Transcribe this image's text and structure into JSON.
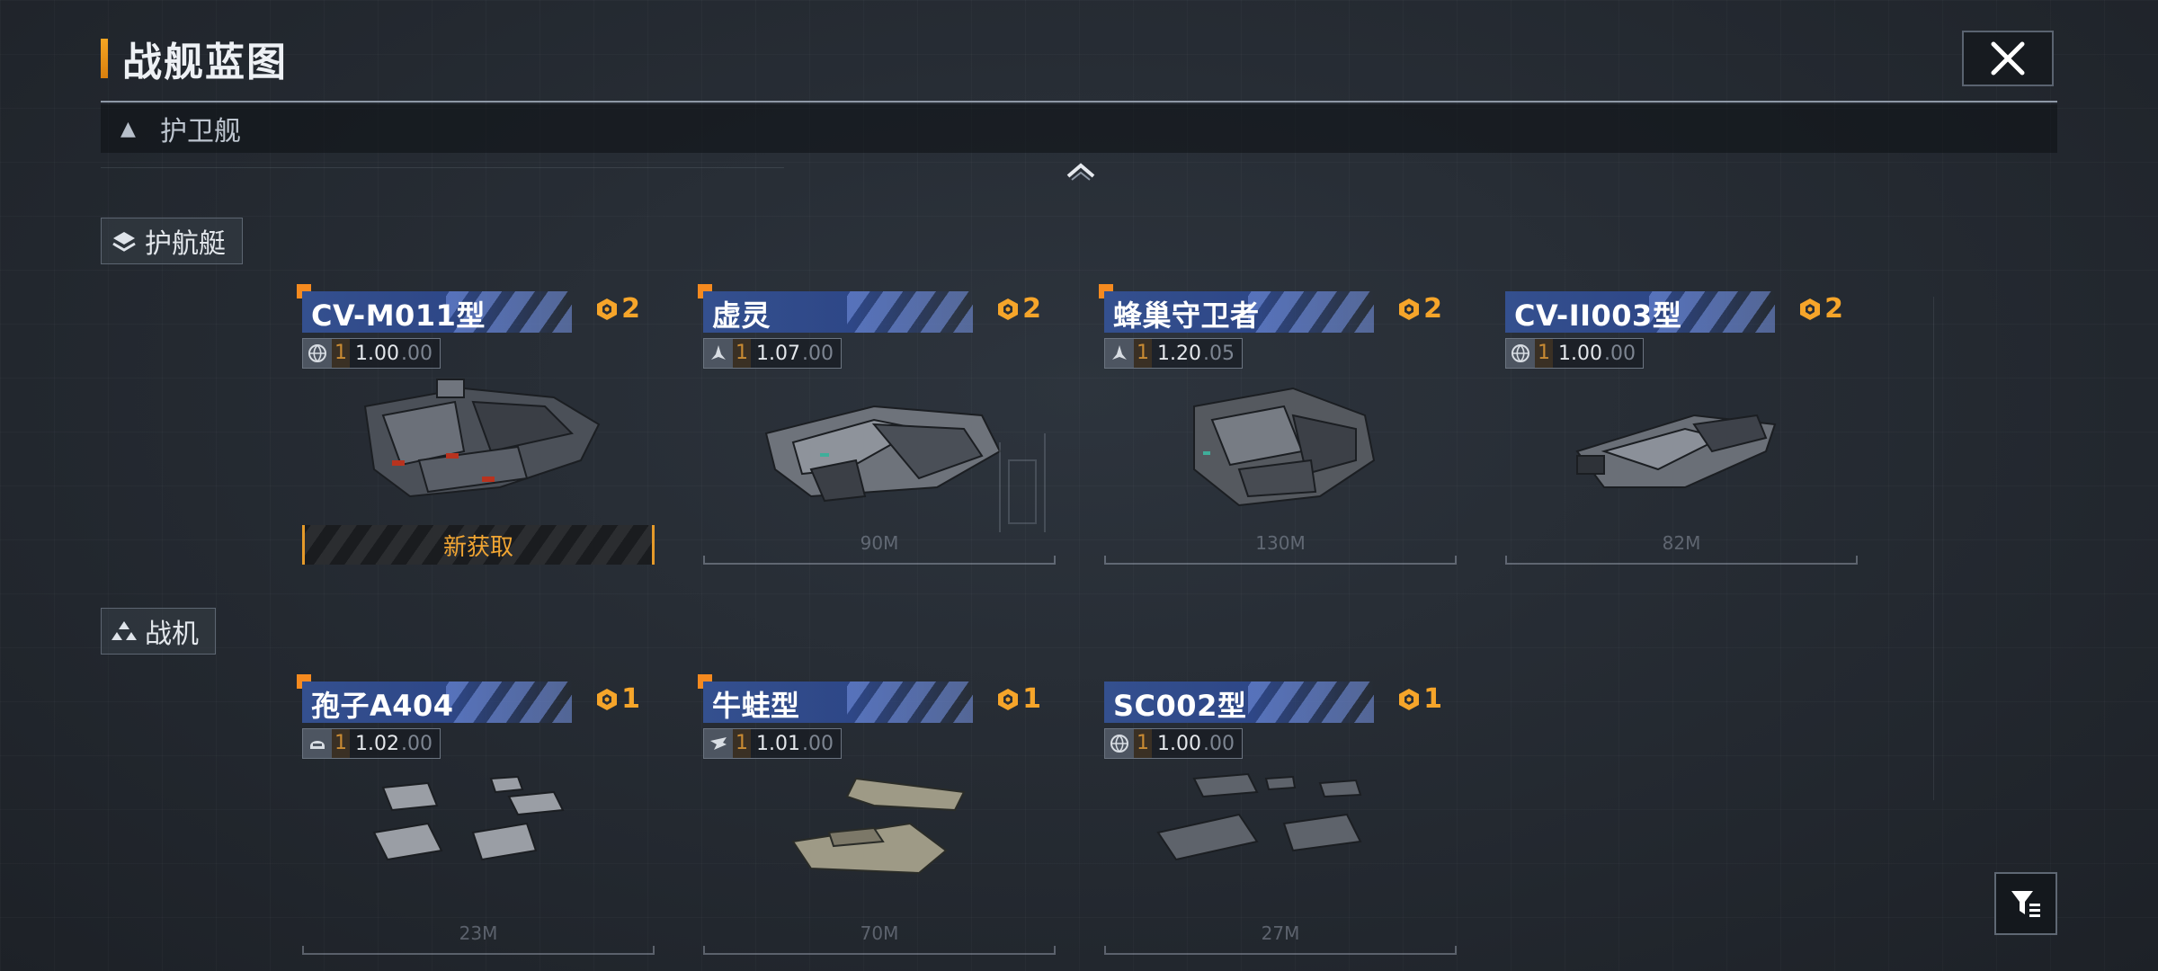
{
  "header": {
    "title": "战舰蓝图",
    "close_icon": "close-icon"
  },
  "category": {
    "label": "护卫舰",
    "icon": "triangle-up-icon"
  },
  "sections": [
    {
      "label": "护航艇",
      "icon": "layers-icon",
      "cards": [
        {
          "name": "CV-M011型",
          "cost": "2",
          "type_icon": "globe-icon",
          "level": "1",
          "value": "1.00",
          "bonus": ".00",
          "length": "",
          "new": true,
          "new_acquired_label": "新获取"
        },
        {
          "name": "虚灵",
          "cost": "2",
          "type_icon": "ship-silhouette-icon",
          "level": "1",
          "value": "1.07",
          "bonus": ".00",
          "length": "90M",
          "new": true
        },
        {
          "name": "蜂巢守卫者",
          "cost": "2",
          "type_icon": "ship-silhouette-icon",
          "level": "1",
          "value": "1.20",
          "bonus": ".05",
          "length": "130M",
          "new": true
        },
        {
          "name": "CV-II003型",
          "cost": "2",
          "type_icon": "globe-icon",
          "level": "1",
          "value": "1.00",
          "bonus": ".00",
          "length": "82M",
          "new": false
        }
      ]
    },
    {
      "label": "战机",
      "icon": "squadron-icon",
      "cards": [
        {
          "name": "孢子A404",
          "cost": "1",
          "type_icon": "helmet-icon",
          "level": "1",
          "value": "1.02",
          "bonus": ".00",
          "length": "23M",
          "new": true
        },
        {
          "name": "牛蛙型",
          "cost": "1",
          "type_icon": "wing-icon",
          "level": "1",
          "value": "1.01",
          "bonus": ".00",
          "length": "70M",
          "new": true
        },
        {
          "name": "SC002型",
          "cost": "1",
          "type_icon": "globe-icon",
          "level": "1",
          "value": "1.00",
          "bonus": ".00",
          "length": "27M",
          "new": false
        }
      ]
    }
  ],
  "filter_icon": "filter-icon",
  "colors": {
    "accent": "#f5a623",
    "name_band": "#34508f",
    "cost": "#f6a52a"
  }
}
